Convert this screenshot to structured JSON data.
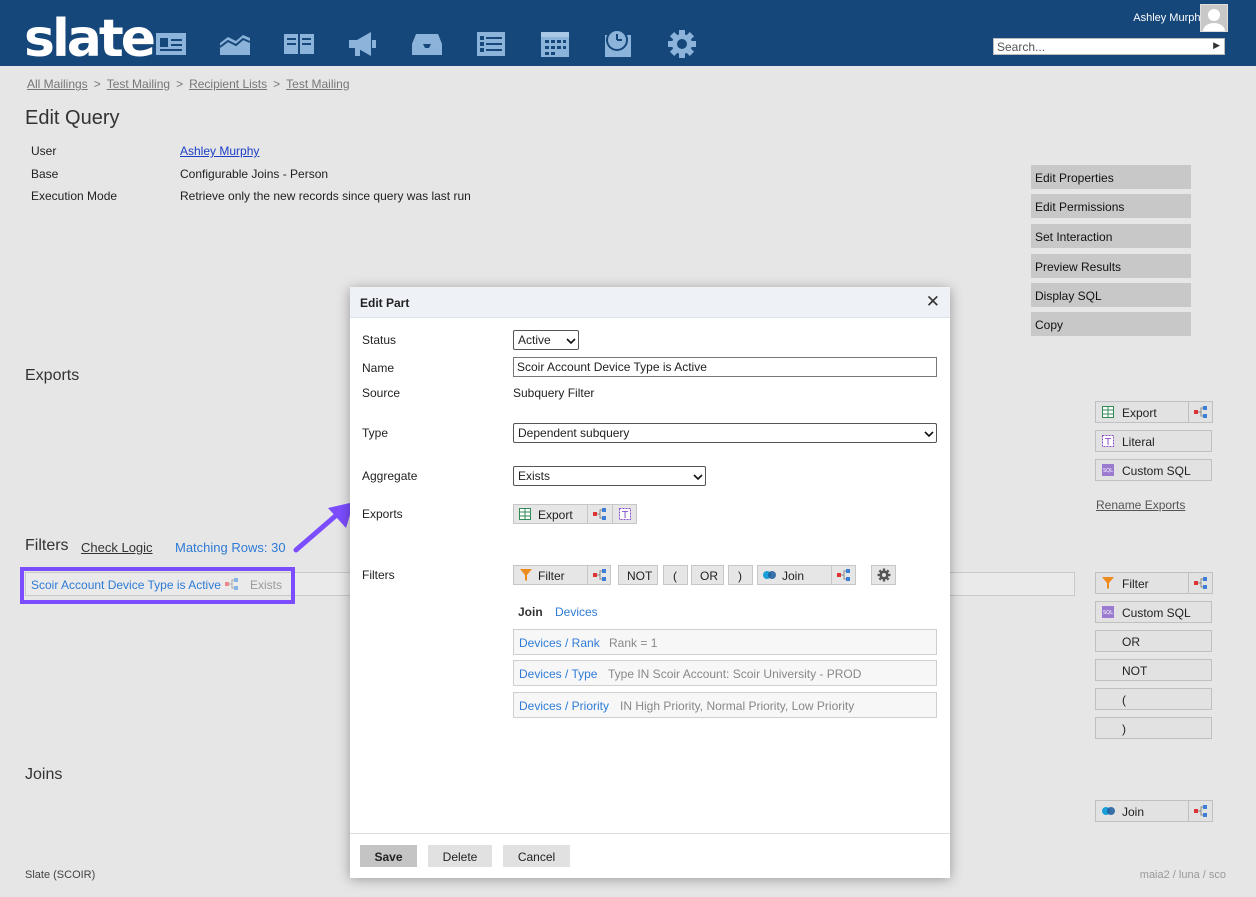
{
  "app": {
    "logo": "slate",
    "user": "Ashley Murphy",
    "search_placeholder": "Search..."
  },
  "nav_icons": [
    "contact-card-icon",
    "area-chart-icon",
    "book-icon",
    "megaphone-icon",
    "inbox-icon",
    "list-icon",
    "calendar-icon",
    "calendar-clock-icon",
    "gear-icon"
  ],
  "breadcrumbs": [
    "All Mailings",
    "Test Mailing",
    "Recipient Lists",
    "Test Mailing"
  ],
  "breadcrumb_sep": ">",
  "page": {
    "title": "Edit Query",
    "props": [
      {
        "label": "User",
        "value": "Ashley Murphy"
      },
      {
        "label": "Base",
        "value": "Configurable Joins - Person"
      },
      {
        "label": "Execution Mode",
        "value": "Retrieve only the new records since query was last run"
      }
    ]
  },
  "side_actions": [
    "Edit Properties",
    "Edit Permissions",
    "Set Interaction",
    "Preview Results",
    "Display SQL",
    "Copy"
  ],
  "exports_section": {
    "title": "Exports",
    "buttons": {
      "export": "Export",
      "literal": "Literal",
      "custom_sql": "Custom SQL"
    },
    "rename": "Rename Exports"
  },
  "filters_section": {
    "title": "Filters",
    "check_logic": "Check Logic",
    "matching_rows": "Matching Rows: 30",
    "item": {
      "label": "Scoir Account Device Type is Active",
      "sub": "Exists"
    },
    "buttons": {
      "filter": "Filter",
      "custom_sql": "Custom SQL",
      "or": "OR",
      "not": "NOT",
      "open_paren": "(",
      "close_paren": ")"
    }
  },
  "joins_section": {
    "title": "Joins",
    "button": "Join"
  },
  "footer": {
    "left": "Slate (SCOIR)",
    "right": "maia2 / luna / sco"
  },
  "modal": {
    "title": "Edit Part",
    "status_label": "Status",
    "status_value": "Active",
    "name_label": "Name",
    "name_value": "Scoir Account Device Type is Active",
    "source_label": "Source",
    "source_value": "Subquery Filter",
    "type_label": "Type",
    "type_value": "Dependent subquery",
    "aggregate_label": "Aggregate",
    "aggregate_value": "Exists",
    "exports_label": "Exports",
    "export_button": "Export",
    "filters_label": "Filters",
    "filter_buttons": {
      "filter": "Filter",
      "not": "NOT",
      "open_paren": "(",
      "or": "OR",
      "close_paren": ")",
      "join": "Join"
    },
    "join_heading": "Join",
    "join_link": "Devices",
    "conditions": [
      {
        "key": "Devices / Rank",
        "value": "Rank = 1"
      },
      {
        "key": "Devices / Type",
        "value": "Type IN Scoir Account: Scoir University - PROD"
      },
      {
        "key": "Devices / Priority",
        "value": "IN High Priority, Normal Priority, Low Priority"
      }
    ],
    "footer_buttons": {
      "save": "Save",
      "delete": "Delete",
      "cancel": "Cancel"
    }
  },
  "colors": {
    "topbar": "#15477a",
    "link": "#2e7bd6",
    "highlight": "#7c4dff",
    "background": "#e6e6e6"
  }
}
